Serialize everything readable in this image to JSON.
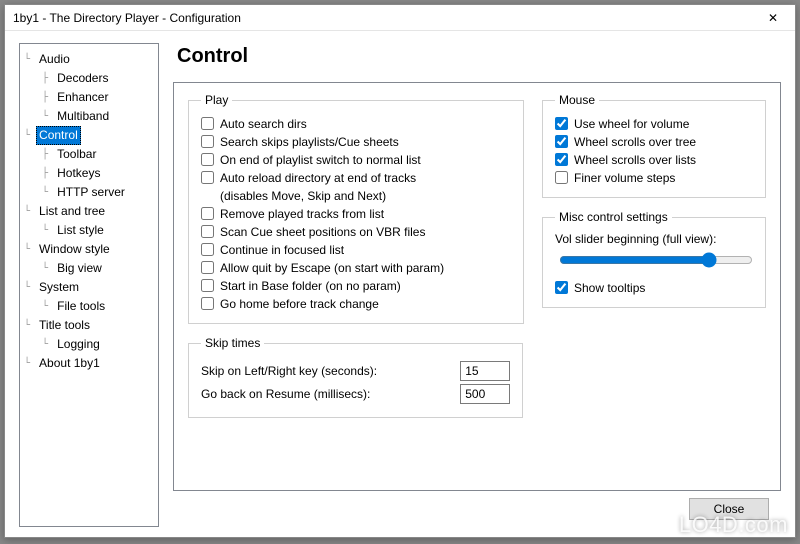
{
  "window": {
    "title": "1by1 - The Directory Player - Configuration",
    "close_glyph": "✕"
  },
  "tree": {
    "audio": {
      "label": "Audio",
      "decoders": "Decoders",
      "enhancer": "Enhancer",
      "multiband": "Multiband"
    },
    "control": {
      "label": "Control",
      "selected": true,
      "toolbar": "Toolbar",
      "hotkeys": "Hotkeys",
      "http_server": "HTTP server"
    },
    "list_and_tree": {
      "label": "List and tree",
      "list_style": "List style"
    },
    "window_style": {
      "label": "Window style",
      "big_view": "Big view"
    },
    "system": {
      "label": "System",
      "file_tools": "File tools"
    },
    "title_tools": {
      "label": "Title tools",
      "logging": "Logging"
    },
    "about": {
      "label": "About 1by1"
    }
  },
  "page": {
    "title": "Control",
    "play": {
      "legend": "Play",
      "items": [
        {
          "label": "Auto search dirs",
          "checked": false
        },
        {
          "label": "Search skips playlists/Cue sheets",
          "checked": false
        },
        {
          "label": "On end of playlist switch to normal list",
          "checked": false
        },
        {
          "label": "Auto reload directory at end of tracks\n(disables Move, Skip and Next)",
          "checked": false
        },
        {
          "label": "Remove played tracks from list",
          "checked": false
        },
        {
          "label": "Scan Cue sheet positions on VBR files",
          "checked": false
        },
        {
          "label": "Continue in focused list",
          "checked": false
        },
        {
          "label": "Allow quit by Escape (on start with param)",
          "checked": false
        },
        {
          "label": "Start in Base folder (on no param)",
          "checked": false
        },
        {
          "label": "Go home before track change",
          "checked": false
        }
      ]
    },
    "mouse": {
      "legend": "Mouse",
      "items": [
        {
          "label": "Use wheel for volume",
          "checked": true
        },
        {
          "label": "Wheel scrolls over tree",
          "checked": true
        },
        {
          "label": "Wheel scrolls over lists",
          "checked": true
        },
        {
          "label": "Finer volume steps",
          "checked": false
        }
      ]
    },
    "misc": {
      "legend": "Misc control settings",
      "slider_label": "Vol slider beginning (full view):",
      "slider_value": 80,
      "show_tooltips": {
        "label": "Show tooltips",
        "checked": true
      }
    },
    "skip": {
      "legend": "Skip times",
      "left_right": {
        "label": "Skip on Left/Right key (seconds):",
        "value": "15"
      },
      "resume": {
        "label": "Go back on Resume (millisecs):",
        "value": "500"
      }
    },
    "close_button": "Close"
  },
  "watermark": "LO4D.com"
}
